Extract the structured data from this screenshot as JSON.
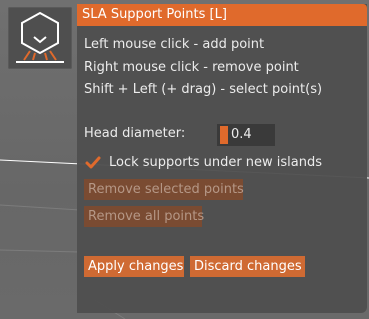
{
  "panel": {
    "title": "SLA Support Points [L]",
    "help": [
      "Left mouse click - add point",
      "Right mouse click - remove point",
      "Shift + Left (+ drag) - select point(s)"
    ],
    "head_diameter_label": "Head diameter:",
    "head_diameter_value": "0.4",
    "head_diameter_fraction": 0.1,
    "lock_supports_label": "Lock supports under new islands",
    "lock_supports_checked": true,
    "remove_selected_label": "Remove selected points",
    "remove_all_label": "Remove all points",
    "apply_label": "Apply changes",
    "discard_label": "Discard changes"
  },
  "toolbar": {
    "tool_icon": "sla-support-points-icon"
  },
  "colors": {
    "accent": "#e06a2c",
    "panel_bg": "#4f4f4f",
    "viewport_bg": "#6b6b6b",
    "disabled_button": "#7a4b32"
  }
}
